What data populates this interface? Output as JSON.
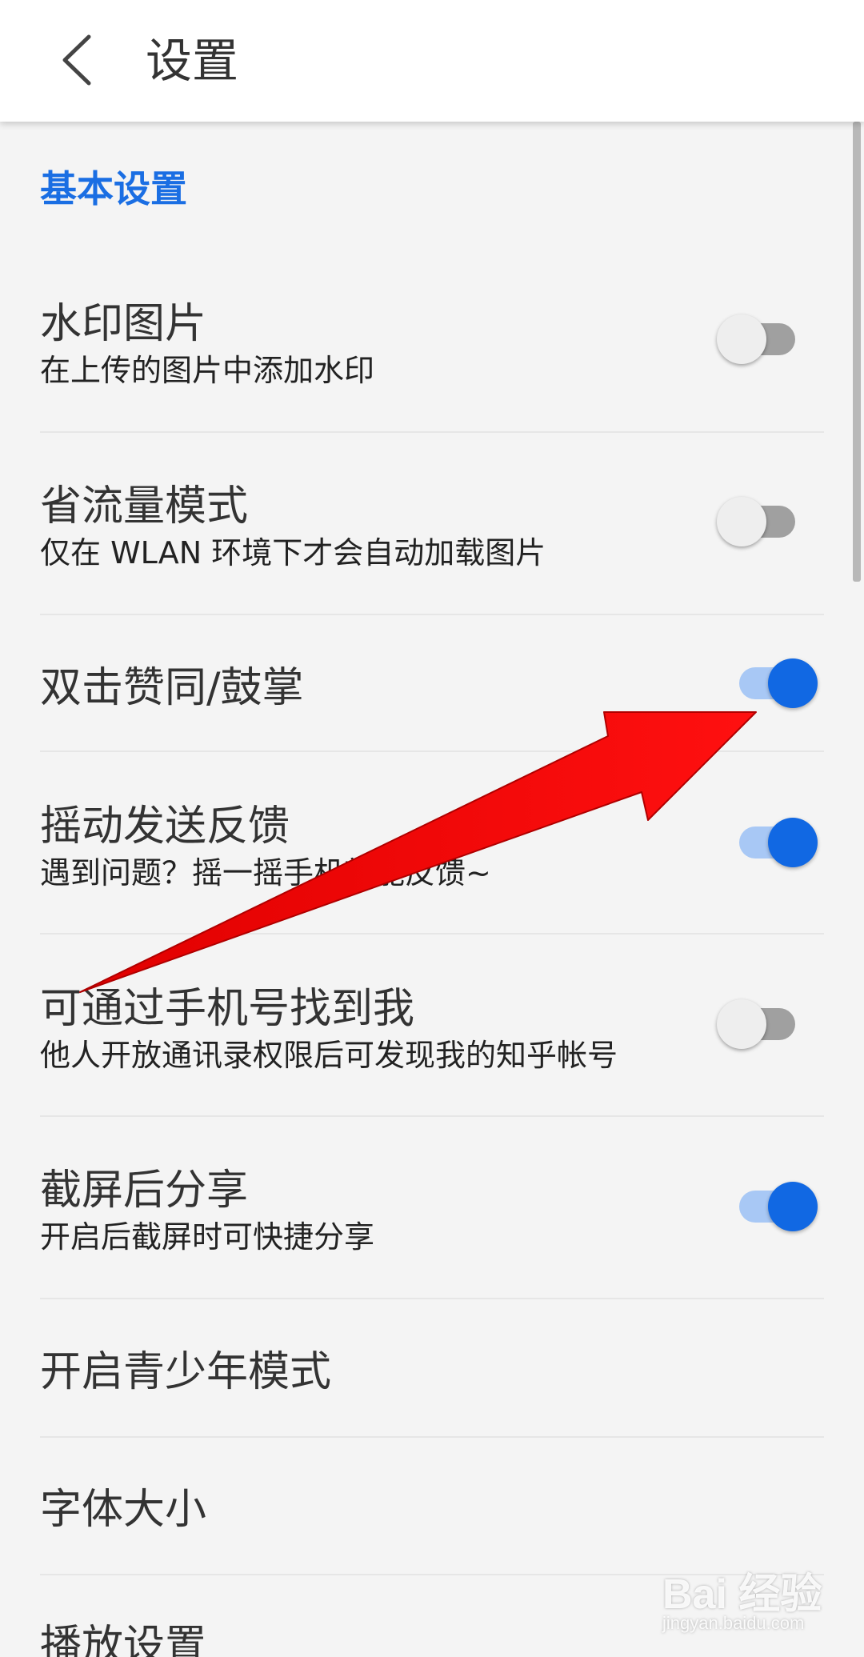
{
  "header": {
    "title": "设置",
    "back_icon": "chevron-left-icon"
  },
  "section": {
    "title": "基本设置"
  },
  "settings": [
    {
      "title": "水印图片",
      "subtitle": "在上传的图片中添加水印",
      "toggle": "off"
    },
    {
      "title": "省流量模式",
      "subtitle": "仅在 WLAN 环境下才会自动加载图片",
      "toggle": "off"
    },
    {
      "title": "双击赞同/鼓掌",
      "subtitle": "",
      "toggle": "on"
    },
    {
      "title": "摇动发送反馈",
      "subtitle": "遇到问题？摇一摇手机就能反馈~",
      "toggle": "on"
    },
    {
      "title": "可通过手机号找到我",
      "subtitle": "他人开放通讯录权限后可发现我的知乎帐号",
      "toggle": "off"
    },
    {
      "title": "截屏后分享",
      "subtitle": "开启后截屏时可快捷分享",
      "toggle": "on"
    },
    {
      "title": "开启青少年模式",
      "subtitle": "",
      "toggle": "none"
    },
    {
      "title": "字体大小",
      "subtitle": "",
      "toggle": "none"
    },
    {
      "title": "播放设置",
      "subtitle": "",
      "toggle": "none"
    }
  ],
  "watermark": {
    "main": "Bai 经验",
    "sub": "jingyan.baidu.com"
  },
  "colors": {
    "accent": "#1168e3",
    "section_title": "#1a6ee3",
    "arrow": "#ff0000",
    "background": "#f4f4f4"
  }
}
